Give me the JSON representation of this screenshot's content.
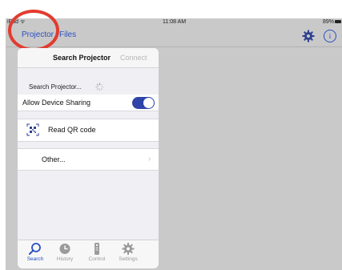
{
  "status_bar": {
    "carrier": "iPad ᯤ",
    "time": "11:08 AM",
    "battery": "89%"
  },
  "nav": {
    "tabs": [
      "Projector",
      "Files"
    ]
  },
  "popover": {
    "title": "Search Projector",
    "connect_label": "Connect",
    "searching_label": "Search Projector...",
    "allow_sharing_label": "Allow Device Sharing",
    "allow_sharing_on": true,
    "qr_label": "Read QR code",
    "other_label": "Other...",
    "other_chevron": "›"
  },
  "tab_bar": {
    "items": [
      {
        "label": "Search",
        "icon": "magnifier-icon",
        "active": true
      },
      {
        "label": "History",
        "icon": "clock-icon",
        "active": false
      },
      {
        "label": "Control",
        "icon": "remote-icon",
        "active": false
      },
      {
        "label": "Settings",
        "icon": "gear-icon",
        "active": false
      }
    ]
  },
  "colors": {
    "accent": "#2a4fc0",
    "toggle": "#2e44a8",
    "annotation": "#e23b2f",
    "background": "#c9c9c9"
  }
}
